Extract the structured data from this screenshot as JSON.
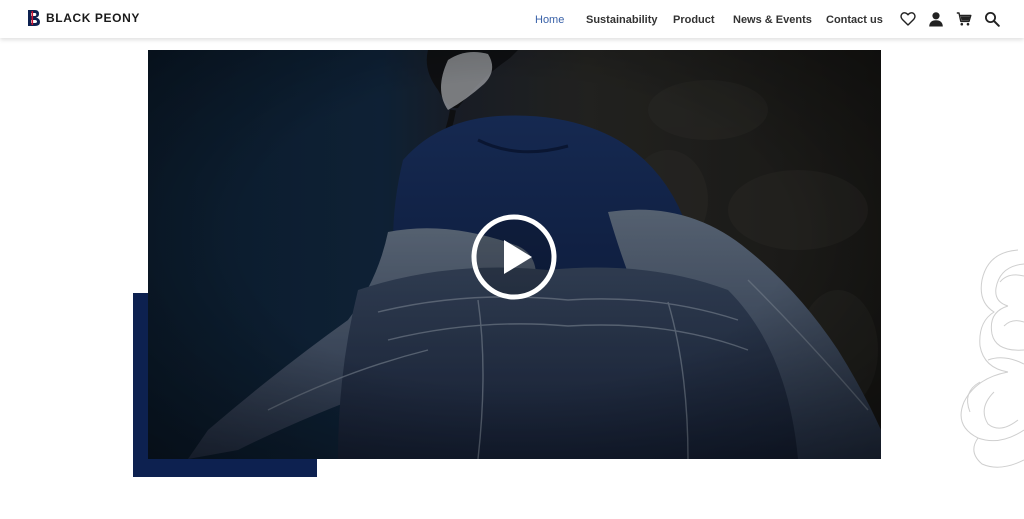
{
  "header": {
    "brand_name": "BLACK PEONY",
    "nav": [
      {
        "label": "Home",
        "active": true
      },
      {
        "label": "Sustainability",
        "active": false
      },
      {
        "label": "Product",
        "active": false
      },
      {
        "label": "News & Events",
        "active": false
      },
      {
        "label": "Contact us",
        "active": false
      }
    ],
    "icons": [
      "heart-icon",
      "user-icon",
      "cart-icon",
      "search-icon"
    ]
  },
  "hero": {
    "media": "video",
    "play_icon": "play-icon"
  },
  "colors": {
    "brand_navy": "#0d2150",
    "brand_red": "#c8102e",
    "nav_active": "#3a62a8",
    "nav_text": "#333333"
  }
}
